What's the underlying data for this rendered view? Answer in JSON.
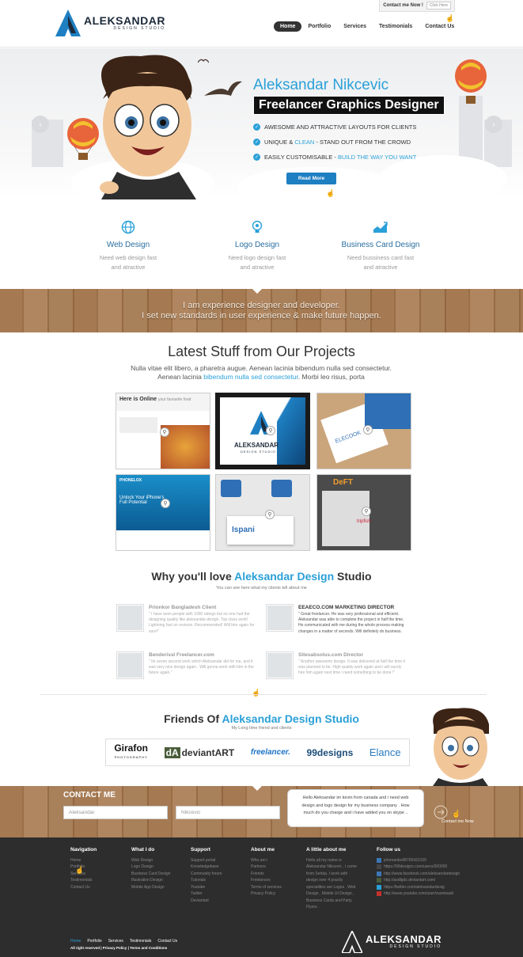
{
  "header": {
    "brand": "ALEKSANDAR",
    "brand_sub": "DESIGN STUDIO",
    "contact_label": "Contact me Now !",
    "contact_button": "Click Here",
    "nav": [
      "Home",
      "Portfolio",
      "Services",
      "Testimonials",
      "Contact Us"
    ],
    "active_nav": "Home"
  },
  "hero": {
    "name": "Aleksandar Nikcevic",
    "tagline": "Freelancer Graphics Designer",
    "features": [
      {
        "text": "AWESOME AND ATTRACTIVE LAYOUTS FOR CLIENTS",
        "pre": "",
        "hl": "",
        "post": ""
      },
      {
        "text": "",
        "pre": "UNIQUE & ",
        "hl": "CLEAN",
        "post": " - STAND OUT FROM THE CROWD"
      },
      {
        "text": "",
        "pre": "EASILY CUSTOMISABLE - ",
        "hl": "BUILD THE WAY YOU WANT",
        "post": ""
      }
    ],
    "read_more": "Read More",
    "prev_arrow": "‹",
    "next_arrow": "›"
  },
  "services": [
    {
      "icon": "globe-icon",
      "title": "Web Design",
      "desc1": "Need web design fast",
      "desc2": "and atractive"
    },
    {
      "icon": "lightbulb-icon",
      "title": "Logo Design",
      "desc1": "Need logo design fast",
      "desc2": "and atractive"
    },
    {
      "icon": "chart-icon",
      "title": "Business Card Design",
      "desc1": "Need bussiness card fast",
      "desc2": "and atractive"
    }
  ],
  "banner": {
    "line1": "I am experience designer and developer.",
    "line2": "I set new standards in user experience & make future happen."
  },
  "projects": {
    "title": "Latest Stuff from Our Projects",
    "desc_pre": "Nulla vitae elit libero, a pharetra augue. Aenean lacinia bibendum nulla sed consectetur. Aenean lacinia ",
    "desc_hl": "bibendum nulla sed consectetur",
    "desc_post": ". Morbi leo risus, porta",
    "thumb1": {
      "caption": "Here is Online",
      "caption2": "your favourite food"
    },
    "thumb2": {
      "caption": "ALEKSANDAR",
      "caption2": "DESIGN STUDIO"
    },
    "thumb3": {
      "caption": "ELECOOK"
    },
    "thumb4": {
      "caption": "PHONELOX",
      "caption2": "Unlock Your iPhone's Full Potential"
    },
    "thumb5": {
      "caption": "Ispani"
    },
    "thumb6": {
      "caption": "DeFT",
      "caption2": "tripfish"
    }
  },
  "why": {
    "pre": "Why you'll love ",
    "hl": "Aleksandar Design",
    "post": " Studio",
    "sub": "You can see here what my clients tell about me",
    "testimonials": [
      {
        "name": "Prionkor Bangladesh Client",
        "quote": "\" I have seen people with 1000 ratings but no one had the designing quality like aleksandar-design. Top class work! Lightning fast on revision. Recommended! Will hire again for sure!\""
      },
      {
        "name": "EEAECO.COM MARKETING DIRECTOR",
        "quote": "\" Great freelancer. He was very professional and efficient. Aleksandar was able to complete the project in half the time. He communicated with me during the whole process making changes in a matter of seconds. Will definitely do business."
      },
      {
        "name": "Benderissl Freelancer.com",
        "quote": "\" Its seven second work which Aleksandar did for me, and it was very nice design again.. Will gonna work with him in the future again.\""
      },
      {
        "name": "Sitesabsolus.com Director",
        "quote": "\" Another awesome design. It was delivered at half the time it was planned to be. High quality work again and i will surely hire him again next time i need something to be done !\""
      }
    ]
  },
  "friends": {
    "pre": "Friends Of ",
    "hl": "Aleksandar Design Studio",
    "sub": "My Long time friend and clients",
    "partners": [
      "Girafon",
      "deviantART",
      "freelancer.",
      "99designs",
      "Elance"
    ],
    "partner_sub": "PHOTOGRAPHY"
  },
  "contact": {
    "title": "CONTACT ME",
    "name_value": "Aleksandar",
    "surname_value": "Nikcevic",
    "message": "Hello Aleksandar im kevin from canada and i need web design and logo design for my business company . How much do you charge and i have added you on skype ..",
    "send_label": "Contact me Now"
  },
  "footer": {
    "navigation": {
      "title": "Navigation",
      "items": [
        "Home",
        "Portfolio",
        "Services",
        "Testimonials",
        "Contact Us"
      ]
    },
    "what": {
      "title": "What I do",
      "items": [
        "Web Design",
        "Logo Design",
        "Business Card Design",
        "Illustration Design",
        "Mobile App Design"
      ]
    },
    "support": {
      "title": "Support",
      "items": [
        "Support portal",
        "Knowledgebase",
        "Community forum",
        "Tutorials",
        "Youtube",
        "Twitter",
        "Deviantart"
      ]
    },
    "about": {
      "title": "About me",
      "items": [
        "Who am i",
        "Partners",
        "Friends",
        "Freelances",
        "Terms of services",
        "Privacy Policy"
      ]
    },
    "little": {
      "title": "A little about me",
      "lines": [
        "Hello all my name is",
        "Aleksandar Nikcevic , i come",
        "from Serbia. I work with",
        "design over 4 practly",
        "specialities are Logos , Web",
        "Design , Mobile UI Design ,",
        "Business Cards and Party",
        "Flyers ."
      ]
    },
    "follow": {
      "title": "Follow us",
      "items": [
        "johnnanbo98765432100",
        "https://99designs.com/users/300095",
        "http://www.facebook.com/aleksandardesign",
        "http://asdlgds.deviantart.com/",
        "https://twitter.com/aleksandardesig",
        "http://www.youtube.com/user/vuxetwadi"
      ]
    },
    "bottom_links": [
      "Home",
      "Portfolio",
      "Services",
      "Testimonials",
      "Contact Us"
    ],
    "legal": [
      "All right reserved",
      "Privacy Policy",
      "Terms and Conditions"
    ],
    "brand": "ALEKSANDAR",
    "brand_sub": "DESIGN STUDIO"
  },
  "colors": {
    "accent": "#2aa0d8",
    "dark": "#2d2d2d",
    "wood": "#a57a52"
  }
}
